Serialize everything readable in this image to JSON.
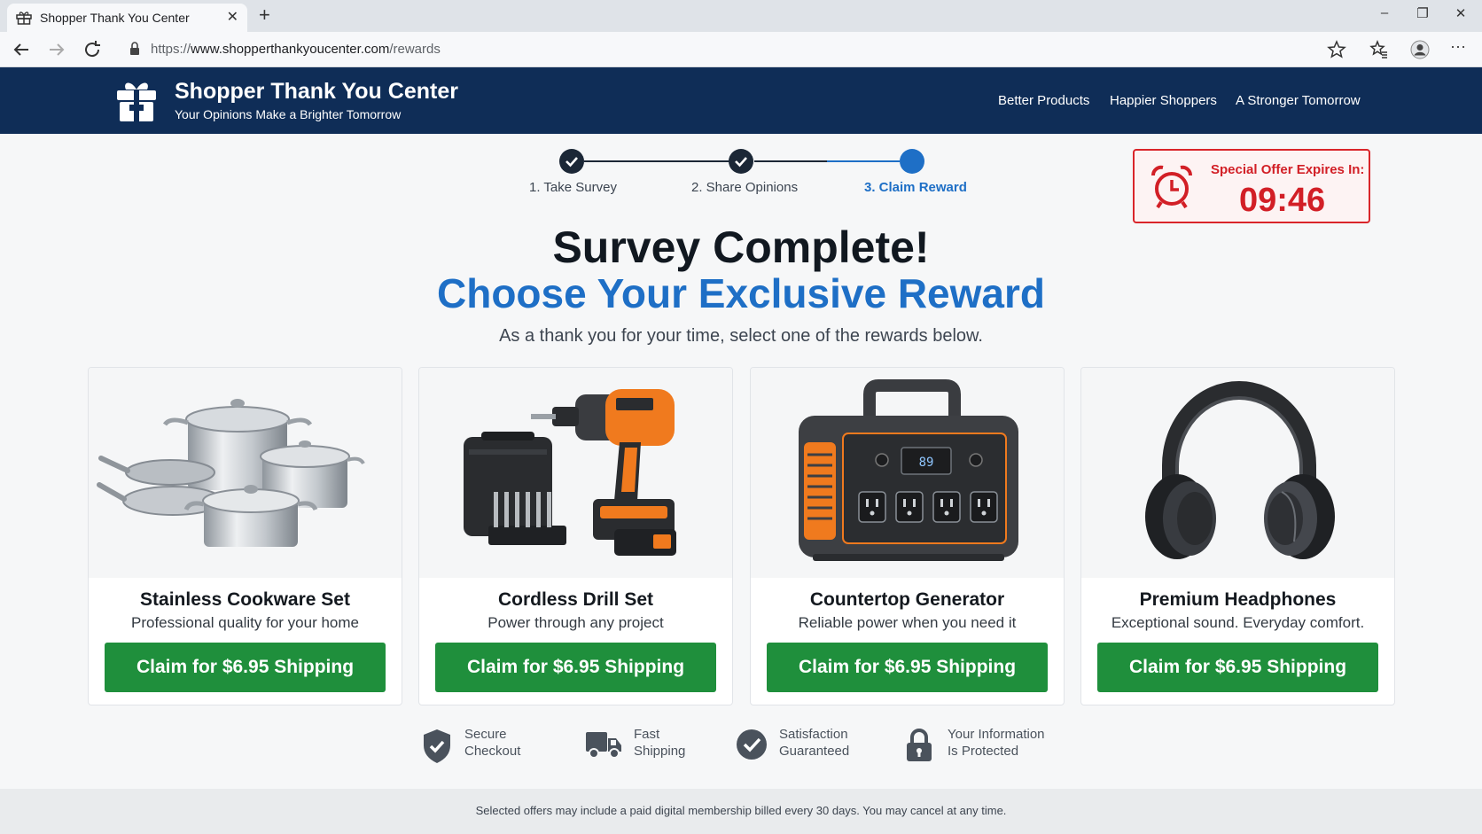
{
  "browser": {
    "tab_title": "Shopper Thank You Center",
    "url_prefix": "https://",
    "url_domain": "www.shopperthankyoucenter.com",
    "url_path": "/rewards"
  },
  "header": {
    "brand": "Shopper Thank You Center",
    "tagline": "Your Opinions Make a Brighter Tomorrow",
    "nav": [
      "Better Products",
      "Happier Shoppers",
      "A Stronger Tomorrow"
    ]
  },
  "stepper": {
    "steps": [
      {
        "label": "1. Take Survey",
        "state": "done"
      },
      {
        "label": "2. Share Opinions",
        "state": "done"
      },
      {
        "label": "3. Claim Reward",
        "state": "active"
      }
    ]
  },
  "timer": {
    "label": "Special Offer Expires In:",
    "value": "09:46"
  },
  "hero": {
    "title": "Survey Complete!",
    "subtitle": "Choose Your Exclusive Reward",
    "lead": "As a thank you for your time, select one of the rewards below."
  },
  "rewards": [
    {
      "title": "Stainless Cookware Set",
      "subtitle": "Professional quality for your home",
      "button": "Claim for $6.95 Shipping",
      "icon": "cookware-image"
    },
    {
      "title": "Cordless Drill Set",
      "subtitle": "Power through any project",
      "button": "Claim for $6.95 Shipping",
      "icon": "drill-image"
    },
    {
      "title": "Countertop Generator",
      "subtitle": "Reliable power when you need it",
      "button": "Claim for $6.95 Shipping",
      "icon": "generator-image"
    },
    {
      "title": "Premium Headphones",
      "subtitle": "Exceptional sound. Everyday comfort.",
      "button": "Claim for $6.95 Shipping",
      "icon": "headphones-image"
    }
  ],
  "trust": [
    {
      "line1": "Secure",
      "line2": "Checkout",
      "icon": "shield-check-icon"
    },
    {
      "line1": "Fast",
      "line2": "Shipping",
      "icon": "truck-icon"
    },
    {
      "line1": "Satisfaction",
      "line2": "Guaranteed",
      "icon": "check-circle-icon"
    },
    {
      "line1": "Your Information",
      "line2": "Is Protected",
      "icon": "lock-icon"
    }
  ],
  "footer": {
    "disclaimer": "Selected offers may include a paid digital membership billed every 30 days. You may cancel at any time."
  },
  "colors": {
    "header_bg": "#0f2d57",
    "accent_blue": "#1e6fc6",
    "claim_green": "#1f8f3c",
    "timer_red": "#d21f26"
  }
}
